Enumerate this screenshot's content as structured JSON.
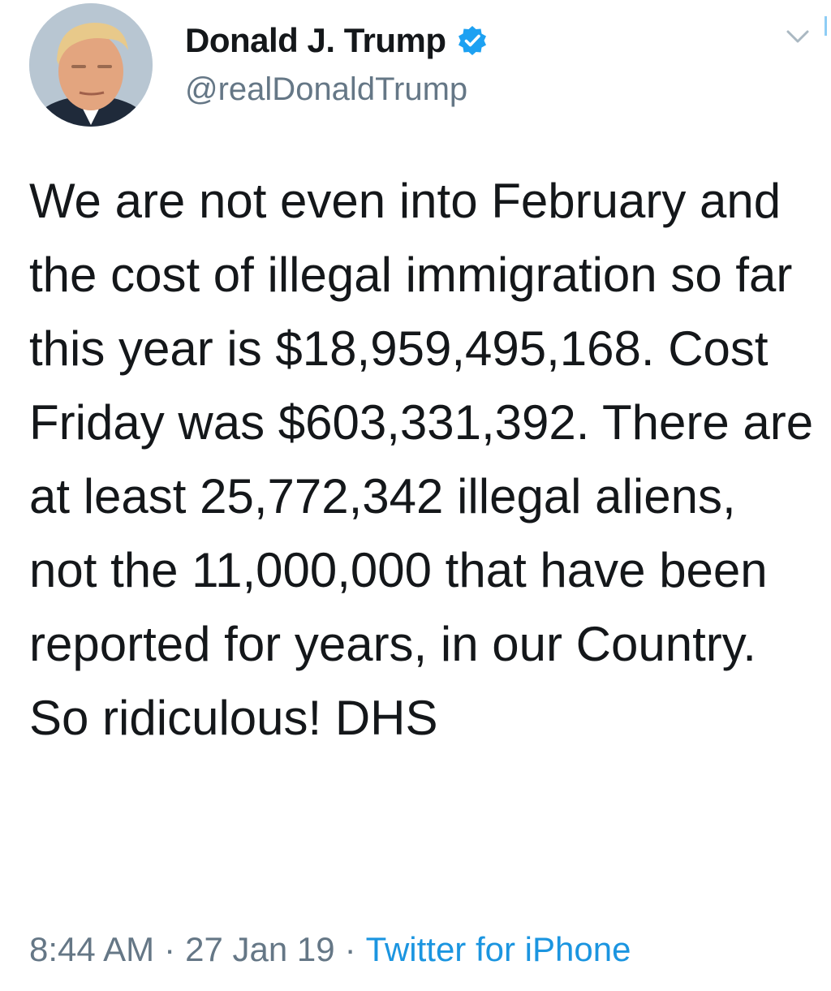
{
  "author": {
    "display_name": "Donald J. Trump",
    "handle": "@realDonaldTrump",
    "verified": true,
    "avatar_icon": "profile-photo"
  },
  "tweet": {
    "text": "We are not even into February and the cost of illegal immigration so far this year is $18,959,495,168. Cost Friday was $603,331,392. There are at least 25,772,342 illegal aliens, not the 11,000,000 that have been reported for years, in our Country. So ridiculous! DHS",
    "time": "8:44 AM",
    "date": "27 Jan 19",
    "separator": "·",
    "source": "Twitter for iPhone"
  },
  "icons": {
    "verified": "verified-badge-icon",
    "menu": "chevron-down-icon"
  },
  "colors": {
    "text_primary": "#14171a",
    "text_secondary": "#657786",
    "link_blue": "#1b95e0",
    "verified_blue": "#1da1f2",
    "background": "#ffffff"
  }
}
